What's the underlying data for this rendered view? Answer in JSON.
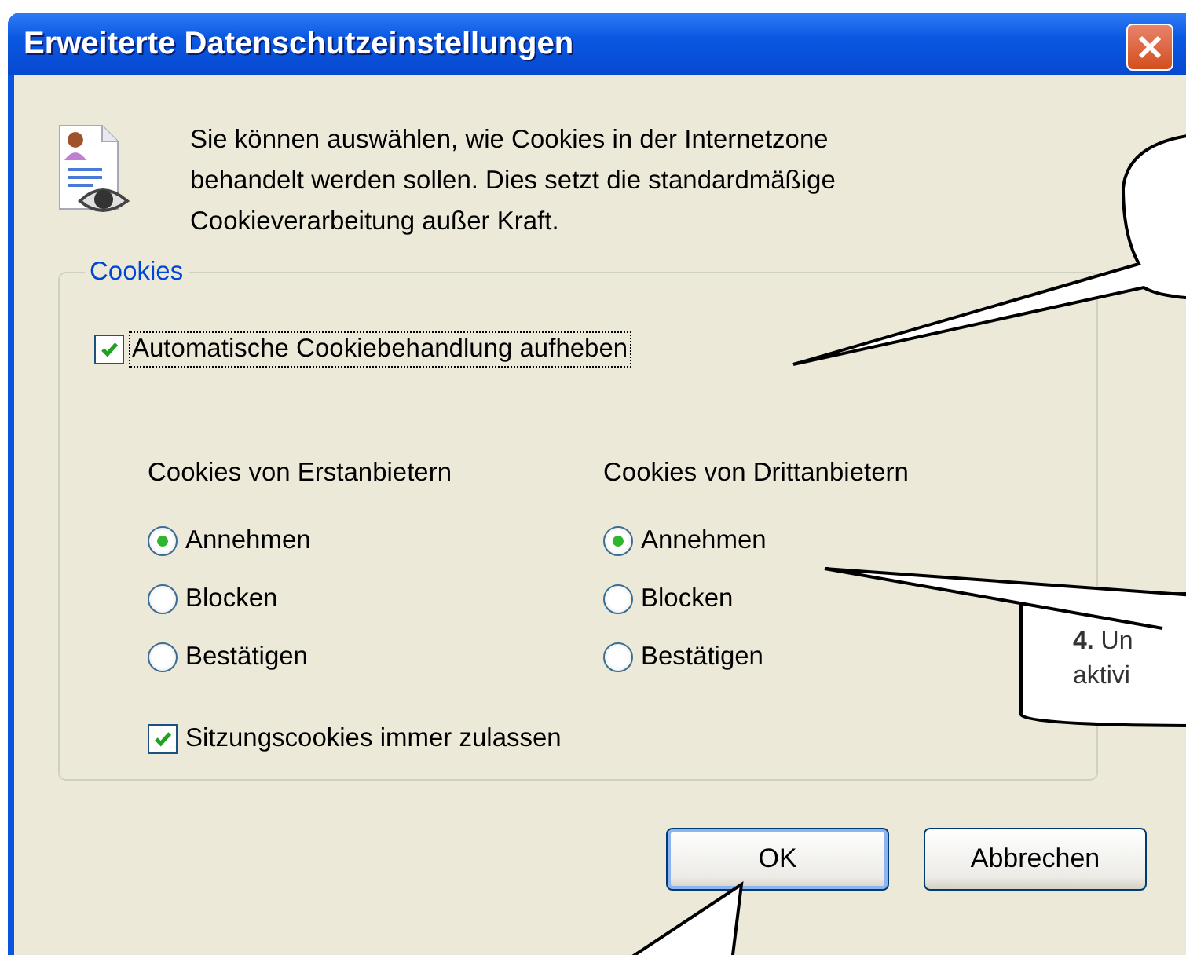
{
  "window": {
    "title": "Erweiterte Datenschutzeinstellungen"
  },
  "intro": "Sie können auswählen, wie Cookies in der Internetzone behandelt werden sollen. Dies setzt die standardmäßige Cookieverarbeitung außer Kraft.",
  "group": {
    "title": "Cookies",
    "override": {
      "label": "Automatische Cookiebehandlung aufheben",
      "checked": true,
      "focused": true
    },
    "columns": [
      {
        "heading": "Cookies von Erstanbietern",
        "options": [
          {
            "label": "Annehmen",
            "selected": true
          },
          {
            "label": "Blocken",
            "selected": false
          },
          {
            "label": "Bestätigen",
            "selected": false
          }
        ]
      },
      {
        "heading": "Cookies von Drittanbietern",
        "options": [
          {
            "label": "Annehmen",
            "selected": true
          },
          {
            "label": "Blocken",
            "selected": false
          },
          {
            "label": "Bestätigen",
            "selected": false
          }
        ]
      }
    ],
    "session": {
      "label": "Sitzungscookies immer zulassen",
      "checked": true
    }
  },
  "buttons": [
    {
      "label": "OK",
      "default": true
    },
    {
      "label": "Abbrechen",
      "default": false
    }
  ],
  "callouts": [
    {
      "kind": "empty"
    },
    {
      "kind": "text",
      "lines": [
        "**4.** Un",
        "aktivi"
      ]
    },
    {
      "kind": "tail"
    }
  ]
}
